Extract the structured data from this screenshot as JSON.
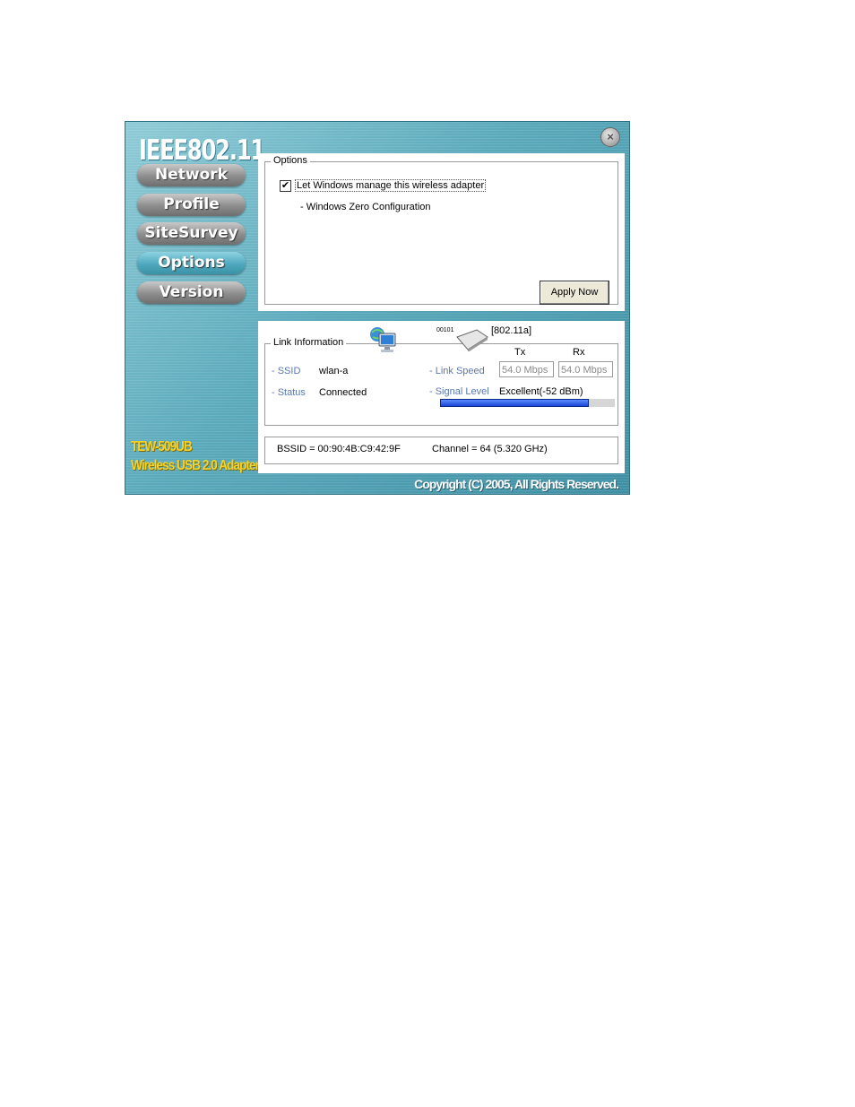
{
  "app": {
    "logo": "IEEE802.11",
    "brand_model": "TEW-509UB",
    "brand_desc": "Wireless USB 2.0 Adapter",
    "copyright": "Copyright (C) 2005, All Rights Reserved.",
    "close_symbol": "×"
  },
  "nav": {
    "items": [
      {
        "label": "Network"
      },
      {
        "label": "Profile"
      },
      {
        "label": "SiteSurvey"
      },
      {
        "label": "Options"
      },
      {
        "label": "Version"
      }
    ],
    "active": "Options"
  },
  "options": {
    "legend": "Options",
    "checkbox_label": "Let Windows manage this wireless adapter",
    "checkbox_checked": true,
    "check_mark": "✔",
    "sub_text": "- Windows Zero Configuration",
    "apply_label": "Apply Now"
  },
  "link": {
    "legend": "Link Information",
    "device_bits": "00101",
    "mode": "[802.11a]",
    "ssid_label": "- SSID",
    "ssid_value": "wlan-a",
    "status_label": "- Status",
    "status_value": "Connected",
    "tx_header": "Tx",
    "rx_header": "Rx",
    "link_speed_label": "- Link Speed",
    "tx_speed": "54.0 Mbps",
    "rx_speed": "54.0 Mbps",
    "signal_label": "- Signal Level",
    "signal_value": "Excellent(-52 dBm)",
    "signal_fraction": 0.85,
    "bssid": "BSSID = 00:90:4B:C9:42:9F",
    "channel": "Channel = 64 (5.320 GHz)"
  },
  "colors": {
    "accent": "#4fa8bd",
    "brand": "#f2d22b",
    "signal_bar": "#1b45d6"
  }
}
